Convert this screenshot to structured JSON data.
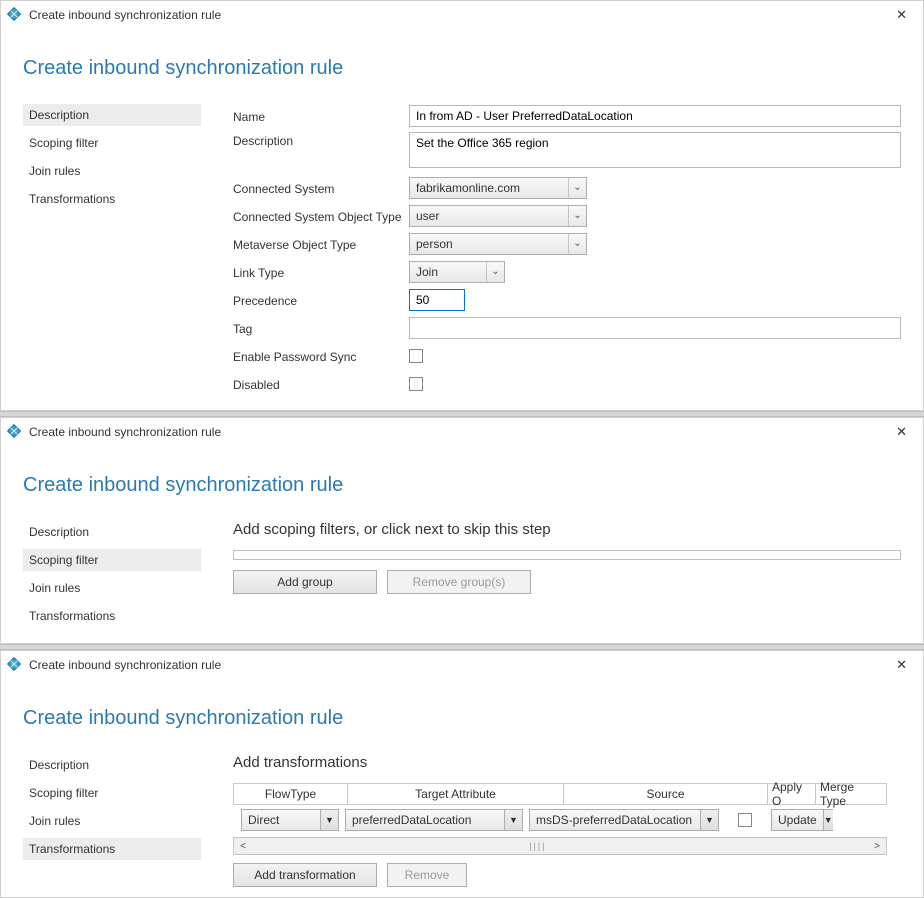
{
  "window_title": "Create inbound synchronization rule",
  "page_heading": "Create inbound synchronization rule",
  "nav": {
    "description": "Description",
    "scoping_filter": "Scoping filter",
    "join_rules": "Join rules",
    "transformations": "Transformations"
  },
  "form": {
    "labels": {
      "name": "Name",
      "description": "Description",
      "connected_system": "Connected System",
      "connected_system_object_type": "Connected System Object Type",
      "metaverse_object_type": "Metaverse Object Type",
      "link_type": "Link Type",
      "precedence": "Precedence",
      "tag": "Tag",
      "enable_password_sync": "Enable Password Sync",
      "disabled": "Disabled"
    },
    "values": {
      "name": "In from AD - User PreferredDataLocation",
      "description": "Set the Office 365 region",
      "connected_system": "fabrikamonline.com",
      "connected_system_object_type": "user",
      "metaverse_object_type": "person",
      "link_type": "Join",
      "precedence": "50",
      "tag": ""
    }
  },
  "panel2": {
    "instruction": "Add scoping filters, or click next to skip this step",
    "add_group": "Add group",
    "remove_groups": "Remove group(s)"
  },
  "panel3": {
    "instruction": "Add transformations",
    "headers": {
      "flow_type": "FlowType",
      "target_attribute": "Target Attribute",
      "source": "Source",
      "apply_once": "Apply O",
      "merge_type": "Merge Type"
    },
    "row": {
      "flow_type": "Direct",
      "target_attribute": "preferredDataLocation",
      "source": "msDS-preferredDataLocation",
      "merge_type": "Update"
    },
    "add_transformation": "Add transformation",
    "remove": "Remove"
  }
}
